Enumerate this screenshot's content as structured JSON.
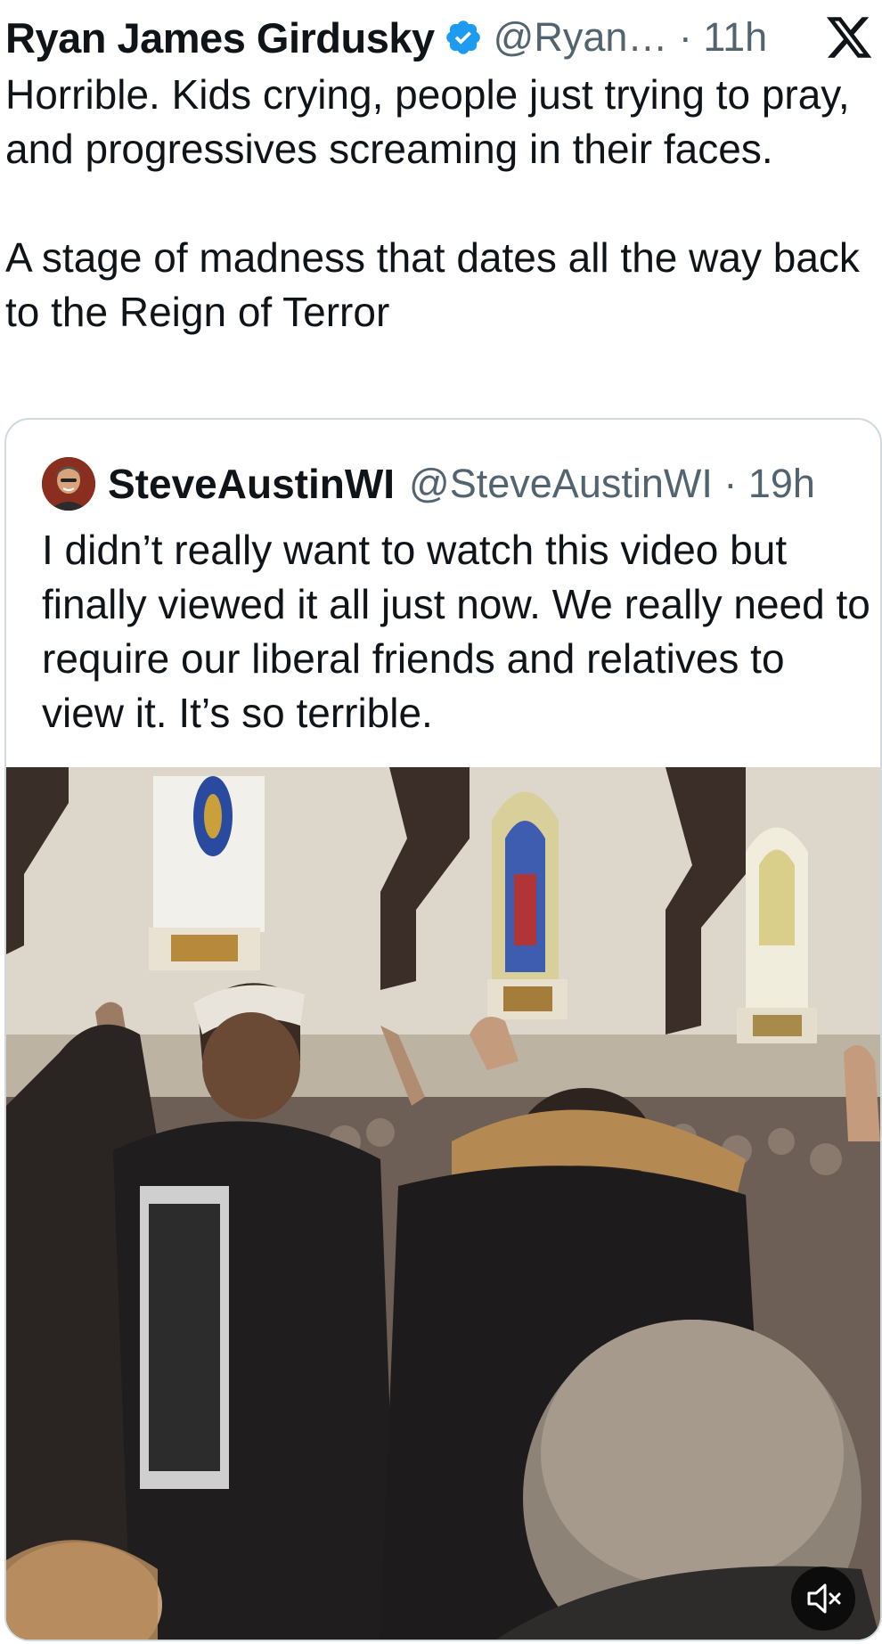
{
  "tweet": {
    "author_name": "Ryan James Girdusky",
    "author_handle": "@Ryan…",
    "time": "11h",
    "paragraphs": [
      "Horrible. Kids crying, people just trying to pray, and progressives screaming in their faces.",
      "A stage of madness that dates all the way back to the Reign of Terror"
    ]
  },
  "quoted": {
    "author_name": "SteveAustinWI",
    "author_handle": "@SteveAustinWI",
    "time": "19h",
    "text": "I didn’t really want to watch this video but finally viewed it all just now. We really need to require our liberal friends and relatives to view it. It’s so terrible."
  },
  "icons": {
    "verified": "verified-badge-icon",
    "brand": "x-logo-icon",
    "mute": "speaker-muted-icon"
  },
  "colors": {
    "text_primary": "#0f1419",
    "text_secondary": "#536471",
    "verified_blue": "#1d9bf0",
    "border": "#cfd9de"
  }
}
